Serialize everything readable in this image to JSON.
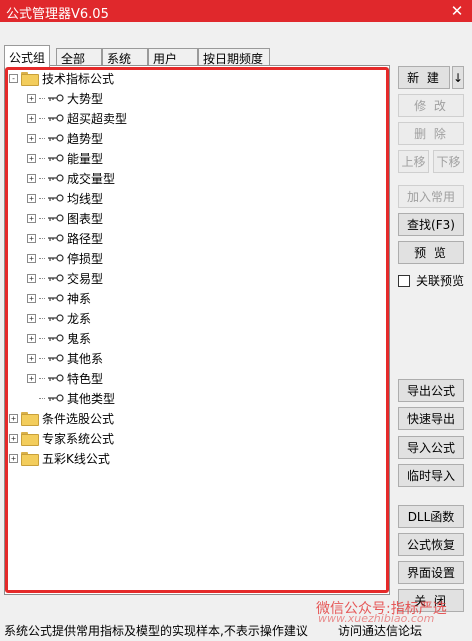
{
  "window": {
    "title": "公式管理器V6.05",
    "close_glyph": "✕"
  },
  "tabs": [
    {
      "label": "公式组",
      "active": true
    },
    {
      "label": "全部"
    },
    {
      "label": "系统"
    },
    {
      "label": "用户"
    },
    {
      "label": "按日期频度"
    }
  ],
  "tree": {
    "root": {
      "label": "技术指标公式",
      "expander": "-"
    },
    "children": [
      {
        "label": "大势型",
        "expander": "+"
      },
      {
        "label": "超买超卖型",
        "expander": "+"
      },
      {
        "label": "趋势型",
        "expander": "+"
      },
      {
        "label": "能量型",
        "expander": "+"
      },
      {
        "label": "成交量型",
        "expander": "+"
      },
      {
        "label": "均线型",
        "expander": "+"
      },
      {
        "label": "图表型",
        "expander": "+"
      },
      {
        "label": "路径型",
        "expander": "+"
      },
      {
        "label": "停损型",
        "expander": "+"
      },
      {
        "label": "交易型",
        "expander": "+"
      },
      {
        "label": "神系",
        "expander": "+"
      },
      {
        "label": "龙系",
        "expander": "+"
      },
      {
        "label": "鬼系",
        "expander": "+"
      },
      {
        "label": "其他系",
        "expander": "+"
      },
      {
        "label": "特色型",
        "expander": "+"
      },
      {
        "label": "其他类型",
        "expander": ""
      }
    ],
    "other_roots": [
      {
        "label": "条件选股公式",
        "expander": "+"
      },
      {
        "label": "专家系统公式",
        "expander": "+"
      },
      {
        "label": "五彩K线公式",
        "expander": "+"
      }
    ]
  },
  "buttons": {
    "new": "新 建",
    "new_arrow": "↓",
    "edit": "修 改",
    "delete": "删 除",
    "move_up": "上移",
    "move_down": "下移",
    "add_common": "加入常用",
    "find": "查找(F3)",
    "preview": "预 览",
    "link_preview": "关联预览",
    "export": "导出公式",
    "quick_export": "快速导出",
    "import": "导入公式",
    "temp_import": "临时导入",
    "dll": "DLL函数",
    "restore": "公式恢复",
    "ui_settings": "界面设置",
    "close": "关 闭"
  },
  "status": {
    "text": "系统公式提供常用指标及模型的实现样本,不表示操作建议",
    "right": "访问通达信论坛"
  },
  "watermark": {
    "line1": "微信公众号:指标严选",
    "line2": "www.xuezhibiao.com"
  },
  "colors": {
    "titlebar": "#e0282c",
    "highlight": "#e52a2a",
    "folder": "#f3cd5c"
  }
}
